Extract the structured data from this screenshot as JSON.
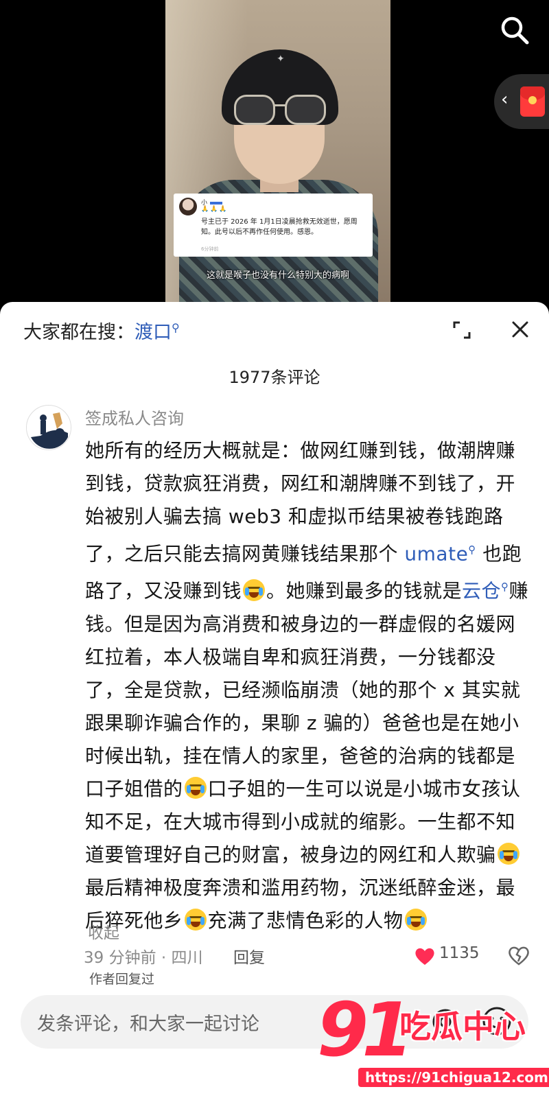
{
  "video": {
    "notice": {
      "name": "小",
      "text": "号主已于 2026 年 1月1日凌晨抢救无效逝世，愿周知。此号以后不再作任何使用。感恩。",
      "time": "6分钟前"
    },
    "subtitle": "这就是喉子也没有什么特别大的病啊"
  },
  "sheet": {
    "hot_search_prefix": "大家都在搜：",
    "hot_search_term": "渡口",
    "comment_count": "1977条评论"
  },
  "comment": {
    "author": "签成私人咨询",
    "segments": [
      "她所有的经历大概就是：做网红赚到钱，做潮牌赚到钱，贷款疯狂消费，网红和潮牌赚不到钱了，开始被别人骗去搞 web3 和虚拟币结果被卷钱跑路了，之后只能去搞网黄赚钱结果那个 ",
      "umate",
      " 也跑路了，又没赚到钱",
      "。她赚到最多的钱就是",
      "云仓",
      "赚钱。但是因为高消费和被身边的一群虚假的名媛网红拉着，本人极端自卑和疯狂消费，一分钱都没了，全是贷款，已经濒临崩溃（她的那个 x 其实就跟果聊诈骗合作的，果聊 z 骗的）爸爸也是在她小时候出轨，挂在情人的家里，爸爸的治病的钱都是口子姐借的",
      "口子姐的一生可以说是小城市女孩认知不足，在大城市得到小成就的缩影。一生都不知道要管理好自己的财富，被身边的网红和人欺骗",
      "最后精神极度奔溃和滥用药物，沉迷纸醉金迷，最后猝死他乡",
      "充满了悲情色彩的人物"
    ],
    "collapse": "收起",
    "time_location": "39 分钟前 · 四川",
    "reply": "回复",
    "likes": "1135",
    "author_replied": "作者回复过"
  },
  "input": {
    "placeholder": "发条评论，和大家一起讨论"
  },
  "watermark": {
    "num": "91",
    "cn": "吃瓜中心",
    "url": "https://91chigua12.com"
  },
  "colors": {
    "link": "#2f5db8",
    "like": "#ff2d55",
    "watermark": "#ff2a4a"
  }
}
